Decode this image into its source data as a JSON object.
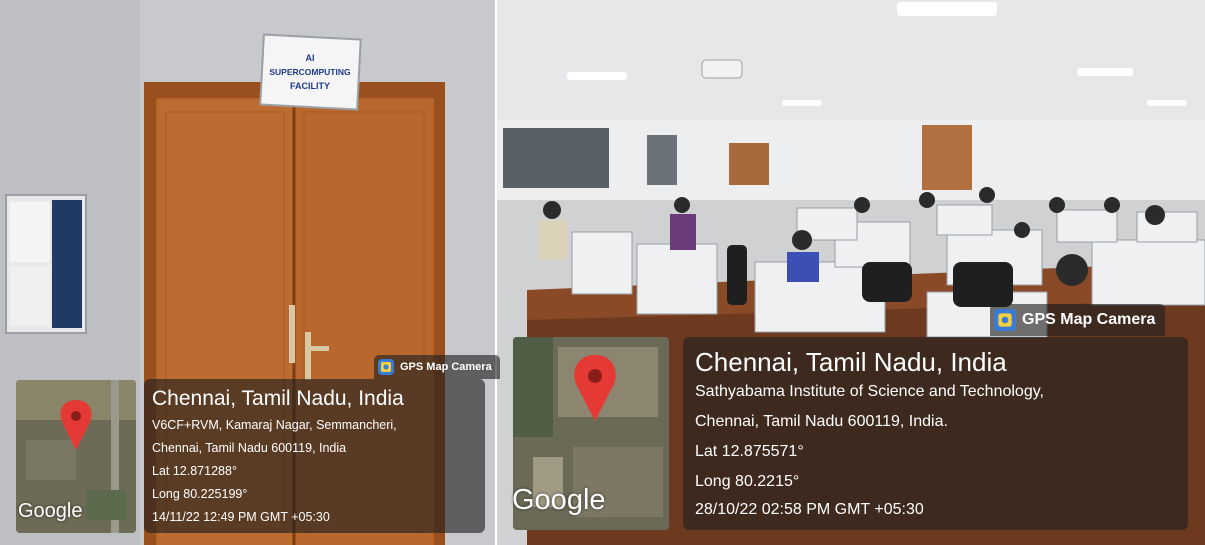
{
  "left_photo": {
    "sign_text": [
      "AI",
      "SUPERCOMPUTING",
      "FACILITY"
    ],
    "badge": {
      "icon": "gps-map-camera-icon",
      "label": "GPS Map Camera"
    },
    "map_brand": "Google",
    "location_title": "Chennai, Tamil Nadu, India",
    "address_lines": [
      "V6CF+RVM, Kamaraj Nagar, Semmancheri,",
      "Chennai, Tamil Nadu 600119, India"
    ],
    "lat": "Lat 12.871288°",
    "long": "Long 80.225199°",
    "timestamp": "14/11/22 12:49 PM GMT +05:30"
  },
  "right_photo": {
    "badge": {
      "icon": "gps-map-camera-icon",
      "label": "GPS Map Camera"
    },
    "map_brand": "Google",
    "location_title": "Chennai, Tamil Nadu, India",
    "address_lines": [
      "Sathyabama Institute of Science and Technology,",
      "Chennai, Tamil Nadu 600119, India."
    ],
    "lat": "Lat 12.875571°",
    "long": "Long 80.2215°",
    "timestamp": "28/10/22 02:58 PM GMT +05:30"
  },
  "colors": {
    "door": "#b5652a",
    "map_pin": "#e53935",
    "overlay": "#1e1e1e",
    "badge_icon": "#3a7bd5"
  }
}
